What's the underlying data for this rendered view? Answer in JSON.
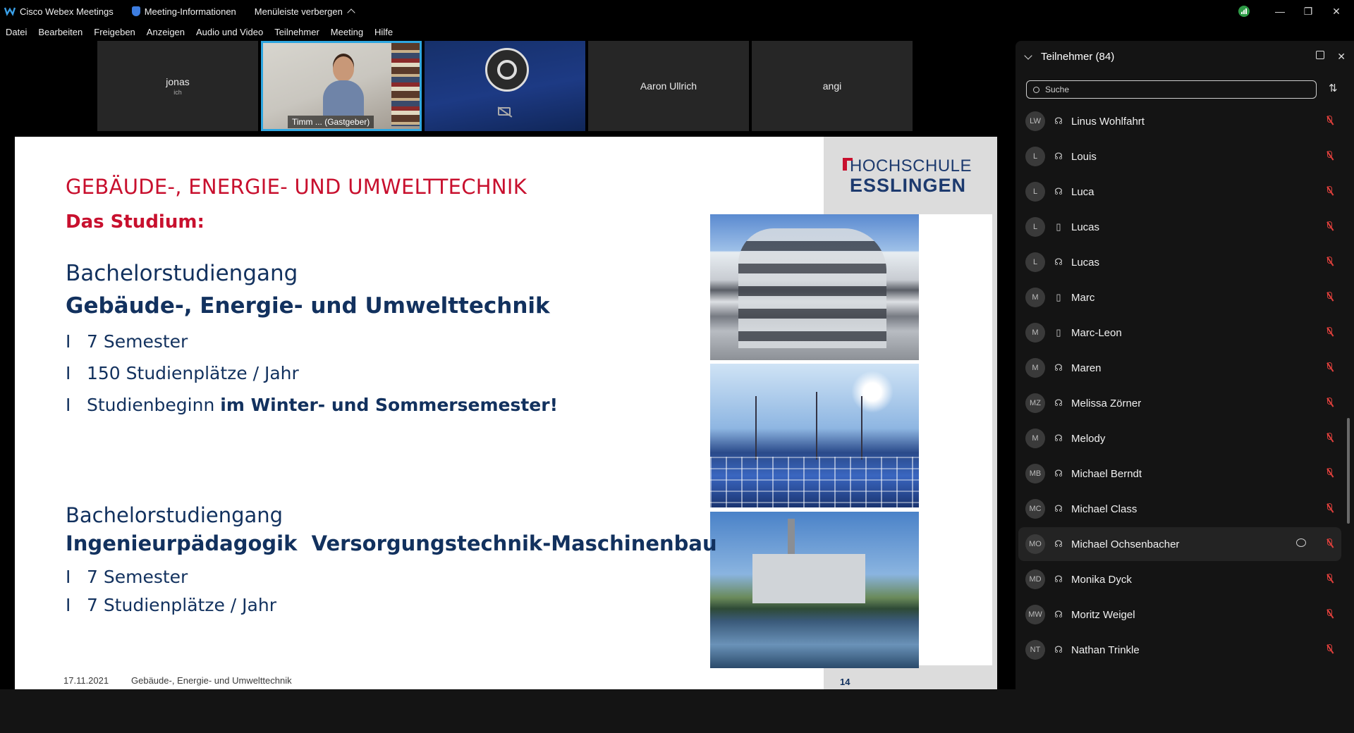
{
  "titlebar": {
    "app_name": "Cisco Webex Meetings",
    "meeting_info": "Meeting-Informationen",
    "hide_menu": "Menüleiste verbergen",
    "minimize": "—",
    "maximize": "❐",
    "close": "✕"
  },
  "menu": [
    "Datei",
    "Bearbeiten",
    "Freigeben",
    "Anzeigen",
    "Audio und Video",
    "Teilnehmer",
    "Meeting",
    "Hilfe"
  ],
  "tiles": [
    {
      "name": "jonas",
      "sub": "ich"
    },
    {
      "name": "Timm ...  (Gastgeber)"
    },
    {
      "name": ""
    },
    {
      "name": "Aaron Ullrich"
    },
    {
      "name": "angi"
    }
  ],
  "slide": {
    "logo_line1": "HOCHSCHULE",
    "logo_line2": "ESSLINGEN",
    "title": "GEBÄUDE-, ENERGIE- UND UMWELTTECHNIK",
    "subtitle": "Das Studium:",
    "b1_heading": "Bachelorstudiengang",
    "b1_program": "Gebäude-, Energie- und Umwelttechnik",
    "b1_items": [
      "7 Semester",
      "150 Studienplätze / Jahr"
    ],
    "b1_item3_normal": "Studienbeginn ",
    "b1_item3_bold": "im Winter- und Sommersemester!",
    "b2_heading": "Bachelorstudiengang",
    "b2_program": "Ingenieurpädagogik  Versorgungstechnik-Maschinenbau",
    "b2_items": [
      "7 Semester",
      "7 Studienplätze / Jahr"
    ],
    "bullet": "I",
    "footer_date": "17.11.2021",
    "footer_title": "Gebäude-, Energie- und Umwelttechnik",
    "page": "14"
  },
  "panel": {
    "title": "Teilnehmer (84)",
    "search_placeholder": "Suche",
    "participants": [
      {
        "initials": "LW",
        "name": "Linus Wohlfahrt",
        "device": "headset"
      },
      {
        "initials": "L",
        "name": "Louis",
        "device": "headset"
      },
      {
        "initials": "L",
        "name": "Luca",
        "device": "headset"
      },
      {
        "initials": "L",
        "name": "Lucas",
        "device": "phone"
      },
      {
        "initials": "L",
        "name": "Lucas",
        "device": "headset"
      },
      {
        "initials": "M",
        "name": "Marc",
        "device": "phone"
      },
      {
        "initials": "M",
        "name": "Marc-Leon",
        "device": "phone"
      },
      {
        "initials": "M",
        "name": "Maren",
        "device": "headset"
      },
      {
        "initials": "MZ",
        "name": "Melissa Zörner",
        "device": "headset"
      },
      {
        "initials": "M",
        "name": "Melody",
        "device": "headset"
      },
      {
        "initials": "MB",
        "name": "Michael Berndt",
        "device": "headset"
      },
      {
        "initials": "MC",
        "name": "Michael Class",
        "device": "headset"
      },
      {
        "initials": "MO",
        "name": "Michael Ochsenbacher",
        "device": "headset",
        "highlighted": true
      },
      {
        "initials": "MD",
        "name": "Monika Dyck",
        "device": "headset"
      },
      {
        "initials": "MW",
        "name": "Moritz Weigel",
        "device": "headset"
      },
      {
        "initials": "NT",
        "name": "Nathan Trinkle",
        "device": "headset"
      }
    ]
  },
  "colors": {
    "accent_red": "#c8102e",
    "slide_blue": "#12315e",
    "active_tile": "#2ea6e0",
    "mute_red": "#e0403c"
  }
}
